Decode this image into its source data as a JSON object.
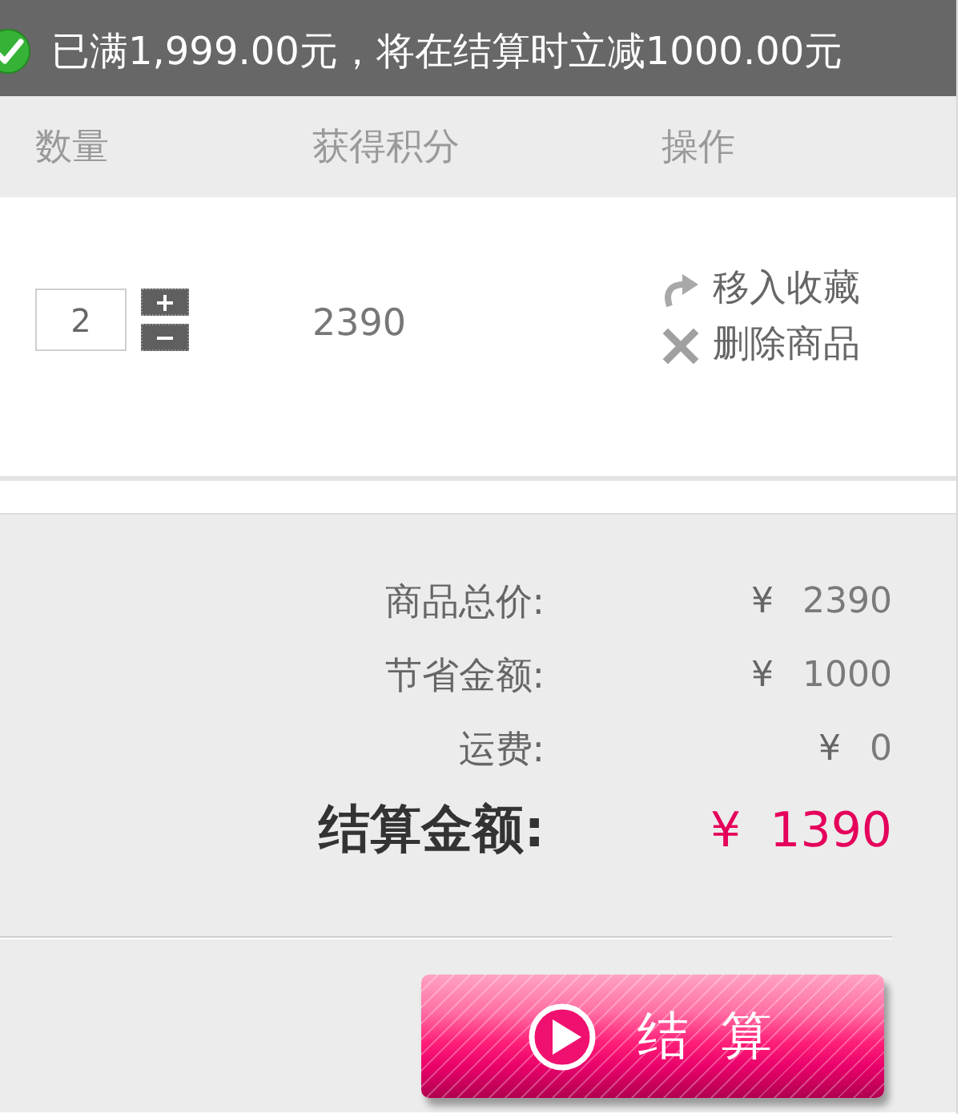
{
  "promo_banner": {
    "text": "已满1,999.00元，将在结算时立减1000.00元"
  },
  "cart_table": {
    "columns": [
      "数量",
      "获得积分",
      "操作"
    ],
    "rows": [
      {
        "quantity": "2",
        "points": "2390",
        "actions": [
          {
            "kind": "favorite",
            "label": "移入收藏"
          },
          {
            "kind": "delete",
            "label": "删除商品"
          }
        ]
      }
    ]
  },
  "summary": {
    "rows": [
      {
        "kind": "normal",
        "label": "商品总价:",
        "currency": "¥",
        "amount": "2390"
      },
      {
        "kind": "normal",
        "label": "节省金额:",
        "currency": "¥",
        "amount": "1000"
      },
      {
        "kind": "normal",
        "label": "运费:",
        "currency": "¥",
        "amount": "0"
      },
      {
        "kind": "total",
        "label": "结算金额:",
        "currency": "¥",
        "amount": "1390"
      }
    ]
  },
  "checkout_button": {
    "label": "结算"
  }
}
